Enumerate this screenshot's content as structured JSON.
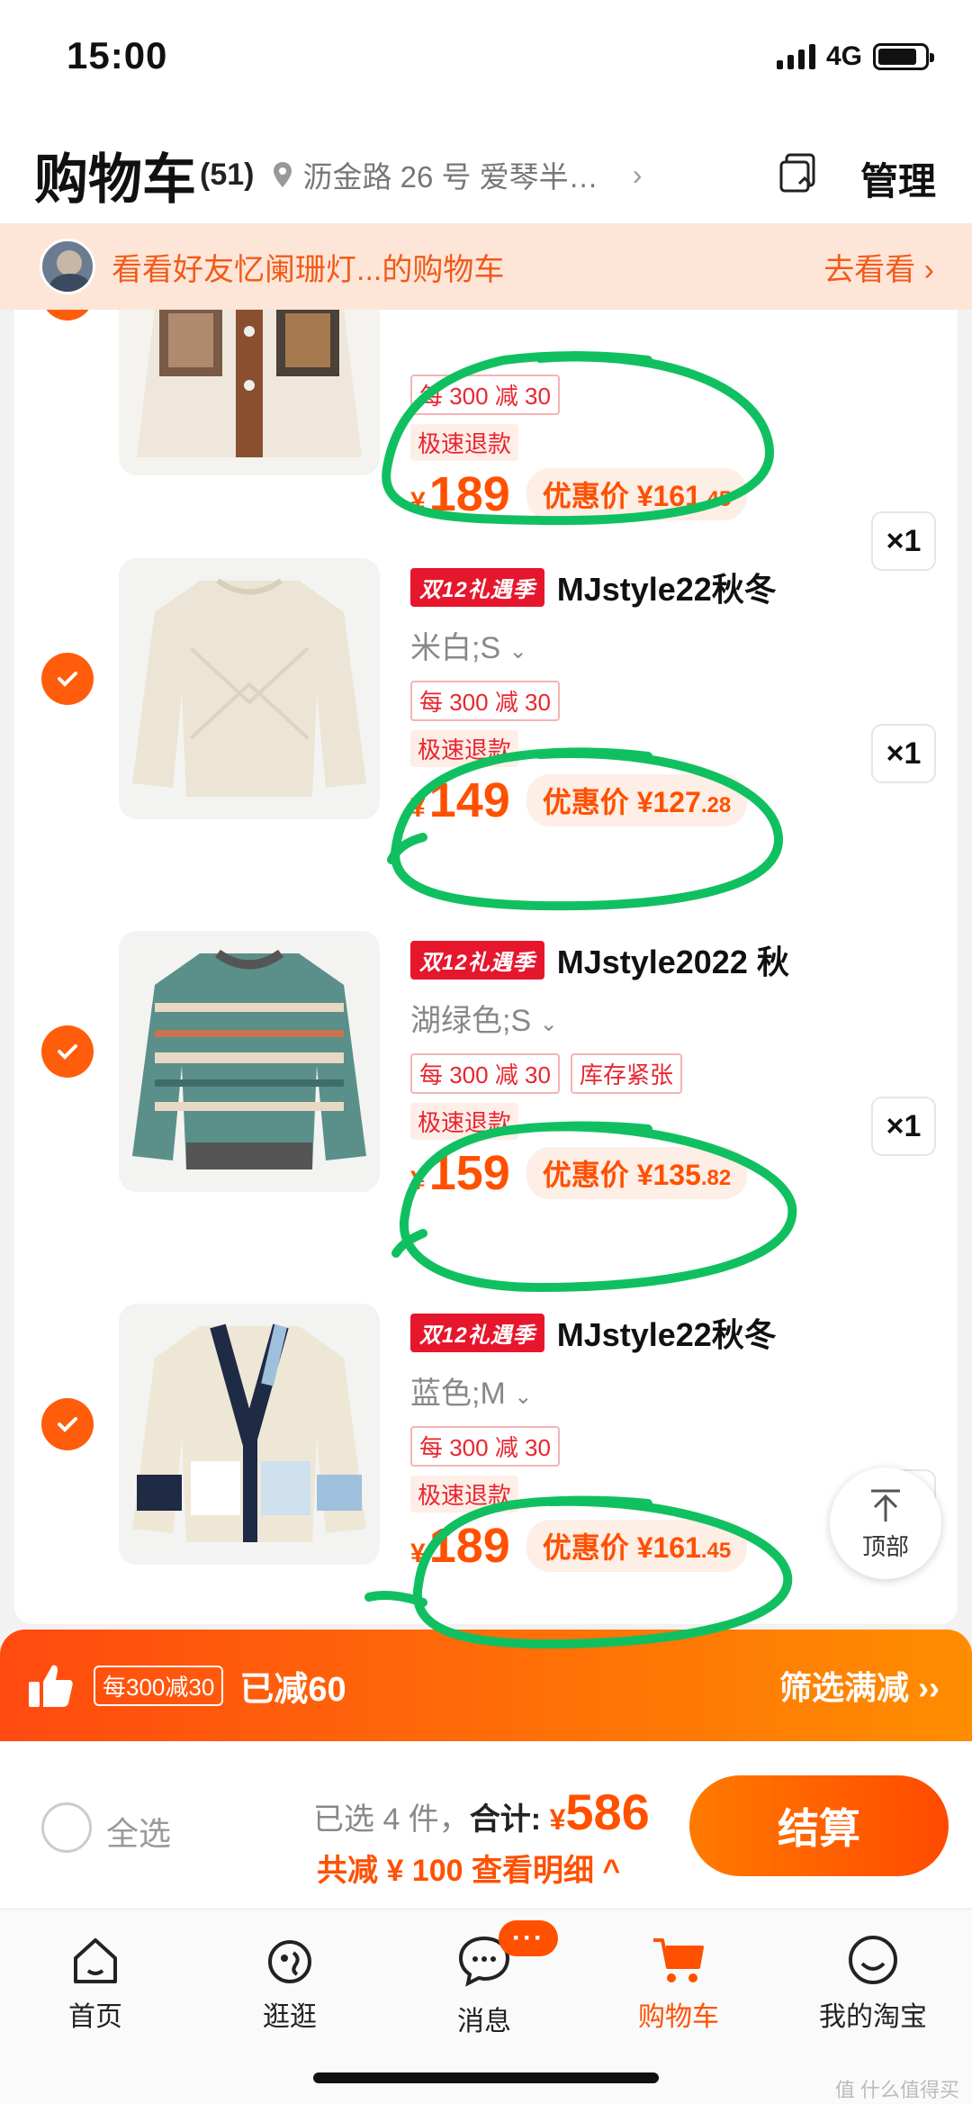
{
  "status_bar": {
    "time": "15:00",
    "network": "4G"
  },
  "header": {
    "title": "购物车",
    "count": "(51)",
    "address": "沥金路 26 号 爱琴半…",
    "manage": "管理"
  },
  "banner": {
    "text": "看看好友忆阑珊灯...的购物车",
    "action": "去看看"
  },
  "items": [
    {
      "badge": "",
      "name": "",
      "spec": "",
      "tags": [
        "每 300 减 30"
      ],
      "refund": "极速退款",
      "price": "189",
      "discount_label": "优惠价",
      "discount_int": "161",
      "discount_dec": ".45",
      "qty": "×1"
    },
    {
      "badge": "双12礼遇季",
      "name": "MJstyle22秋冬",
      "spec": "米白;S",
      "tags": [
        "每 300 减 30"
      ],
      "refund": "极速退款",
      "price": "149",
      "discount_label": "优惠价",
      "discount_int": "127",
      "discount_dec": ".28",
      "qty": "×1"
    },
    {
      "badge": "双12礼遇季",
      "name": "MJstyle2022 秋",
      "spec": "湖绿色;S",
      "tags": [
        "每 300 减 30",
        "库存紧张"
      ],
      "refund": "极速退款",
      "price": "159",
      "discount_label": "优惠价",
      "discount_int": "135",
      "discount_dec": ".82",
      "qty": "×1"
    },
    {
      "badge": "双12礼遇季",
      "name": "MJstyle22秋冬",
      "spec": "蓝色;M",
      "tags": [
        "每 300 减 30"
      ],
      "refund": "极速退款",
      "price": "189",
      "discount_label": "优惠价",
      "discount_int": "161",
      "discount_dec": ".45",
      "qty": "×1"
    }
  ],
  "currency": "¥",
  "top_button": "顶部",
  "promo_bar": {
    "tag": "每300减30",
    "reduced": "已减60",
    "filter": "筛选满减 ››"
  },
  "checkout": {
    "select_all": "全选",
    "selected": "已选 4 件，",
    "total_label": "合计:",
    "total": "586",
    "saved": "共减 ¥ 100  查看明细 ^",
    "pay": "结算"
  },
  "tabs": [
    {
      "label": "首页",
      "icon": "home-icon"
    },
    {
      "label": "逛逛",
      "icon": "browse-icon"
    },
    {
      "label": "消息",
      "icon": "message-icon",
      "badge": "···"
    },
    {
      "label": "购物车",
      "icon": "cart-icon",
      "active": true
    },
    {
      "label": "我的淘宝",
      "icon": "smile-icon"
    }
  ],
  "watermark": "值 什么值得买",
  "colors": {
    "accent": "#ff5000",
    "highlight_marker": "#10c060",
    "badge": "#e6162d"
  }
}
